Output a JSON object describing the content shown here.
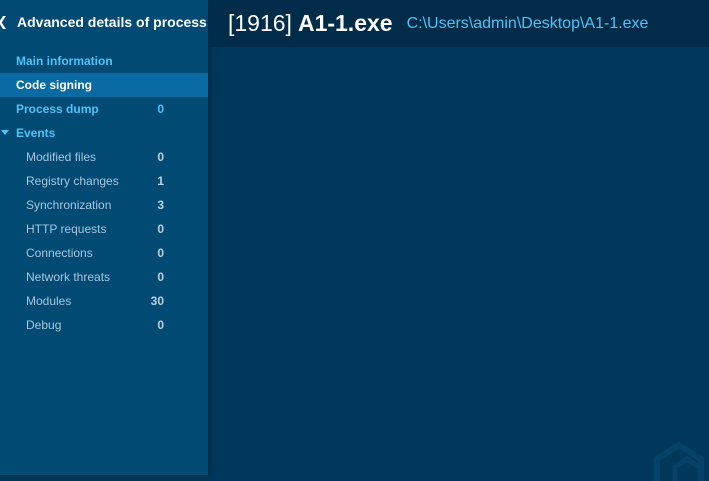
{
  "sidebar": {
    "title": "Advanced details of process",
    "items": [
      {
        "label": "Main information",
        "count": ""
      },
      {
        "label": "Code signing",
        "count": ""
      },
      {
        "label": "Process dump",
        "count": "0"
      },
      {
        "label": "Events",
        "count": ""
      }
    ],
    "events": [
      {
        "label": "Modified files",
        "count": "0"
      },
      {
        "label": "Registry changes",
        "count": "1"
      },
      {
        "label": "Synchronization",
        "count": "3"
      },
      {
        "label": "HTTP requests",
        "count": "0"
      },
      {
        "label": "Connections",
        "count": "0"
      },
      {
        "label": "Network threats",
        "count": "0"
      },
      {
        "label": "Modules",
        "count": "30"
      },
      {
        "label": "Debug",
        "count": "0"
      }
    ]
  },
  "header": {
    "pid": "[1916]",
    "name": "A1-1.exe",
    "path": "C:\\Users\\admin\\Desktop\\A1-1.exe"
  },
  "colors": {
    "sidebar_bg": "#004a73",
    "main_bg": "#00375a",
    "header_bg": "#002b49",
    "selected_bg": "#0a6aa3",
    "accent": "#4fc3f7"
  },
  "icons": {
    "back": "chevron-left-icon",
    "events_toggle": "caret-down-icon",
    "watermark": "logo-watermark-icon"
  }
}
